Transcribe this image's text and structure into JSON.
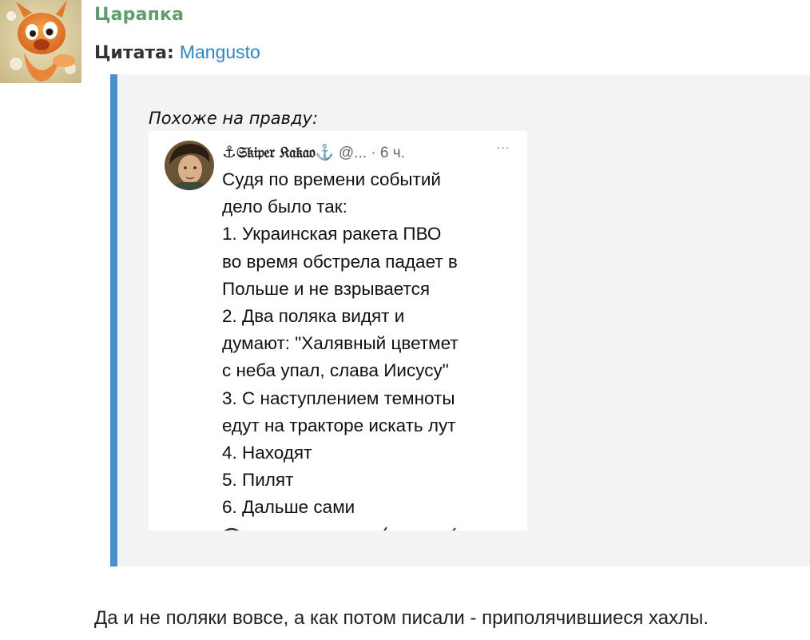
{
  "post": {
    "username": "Царапка",
    "quote": {
      "label": "Цитата:",
      "author": "Mangusto",
      "intro": "Похоже на правду:"
    },
    "reply": "Да и не поляки вовсе, а как потом писали - приполячившиеся хахлы."
  },
  "embedded_tweet": {
    "anchor_glyph": "⚓",
    "display_name": "𝔖𝔨𝔦𝔭𝔢𝔯 𝔎𝔞𝔨𝔞𝔬⚓",
    "handle_time": "@... · 6 ч.",
    "more": "···",
    "lines": [
      "Судя по времени событий",
      "дело было так:",
      "1. Украинская ракета ПВО",
      "во время обстрела падает в",
      "Польше и не взрывается",
      "2. Два поляка видят и",
      "думают: \"Халявный цветмет",
      "с неба упал, слава Иисусу\"",
      "3. С наступлением темноты",
      "едут на тракторе искать лут",
      "4. Находят",
      "5. Пилят",
      "6. Дальше сами"
    ]
  },
  "colors": {
    "username": "#5f9d6d",
    "author_link": "#2e86c1",
    "quote_bar": "#4d8fcc",
    "quote_bg": "#f3f3f3"
  },
  "icons": {
    "user_avatar": "orange-cartoon-avatar",
    "tweet_avatar": "portrait-avatar",
    "more": "more-dots-icon"
  }
}
